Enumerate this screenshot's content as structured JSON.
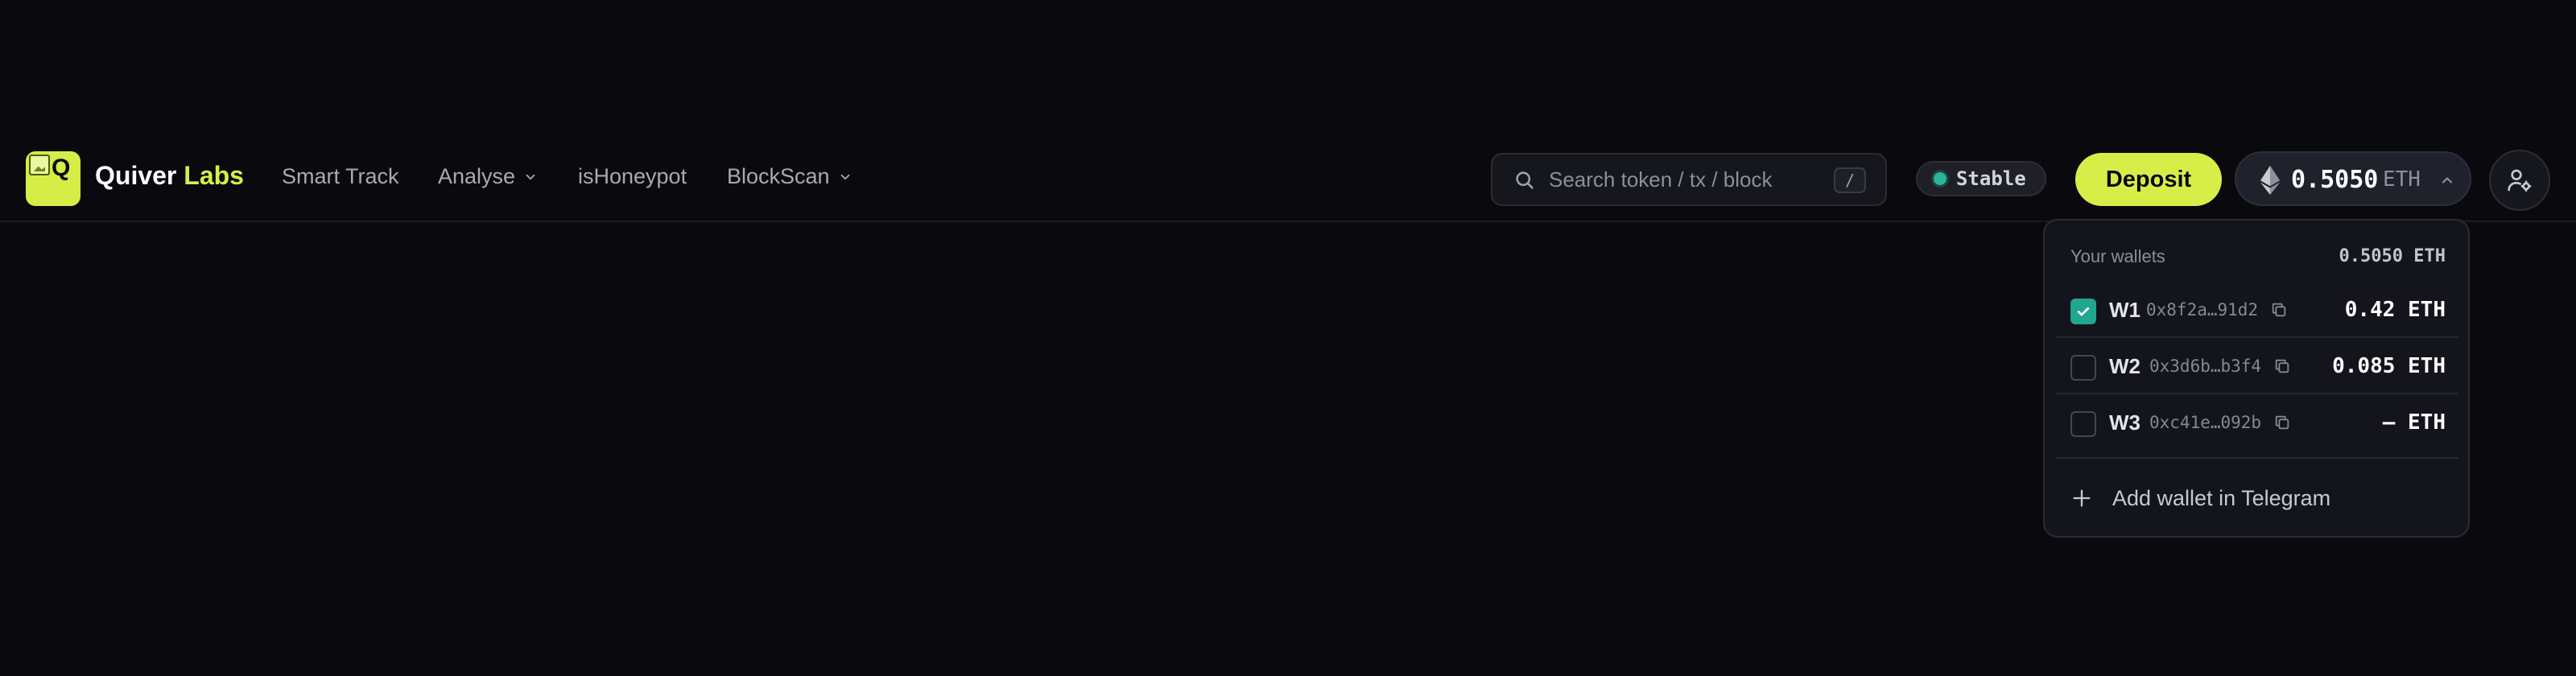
{
  "brand": {
    "logo_alt": "Q",
    "name": "Quiver",
    "accent": "Labs"
  },
  "nav": {
    "items": [
      {
        "label": "Smart Track"
      },
      {
        "label": "Analyse"
      },
      {
        "label": "isHoneypot"
      },
      {
        "label": "BlockScan"
      }
    ]
  },
  "search": {
    "placeholder": "Search token / tx / block",
    "shortcut": "/"
  },
  "status": {
    "label": "Stable"
  },
  "deposit": {
    "label": "Deposit"
  },
  "balance": {
    "amount": "0.5050",
    "unit": "ETH"
  },
  "wallets": {
    "heading": "Your wallets",
    "total": "0.5050 ETH",
    "items": [
      {
        "id": "W1",
        "address": "0x8f2a…91d2",
        "value": "0.42 ETH",
        "checked": true
      },
      {
        "id": "W2",
        "address": "0x3d6b…b3f4",
        "value": "0.085 ETH",
        "checked": false
      },
      {
        "id": "W3",
        "address": "0xc41e…092b",
        "value": "— ETH",
        "checked": false
      }
    ],
    "add_label": "Add wallet in Telegram"
  },
  "colors": {
    "background": "#0a0a0e",
    "accent": "#d8ee48",
    "teal": "#21a690"
  }
}
